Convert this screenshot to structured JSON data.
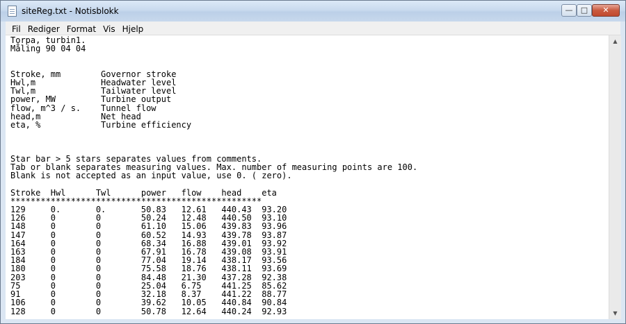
{
  "window": {
    "title": "siteReg.txt - Notisblokk",
    "controls": {
      "minimize": "—",
      "maximize": "□",
      "close": "✕"
    }
  },
  "menu": [
    "Fil",
    "Rediger",
    "Format",
    "Vis",
    "Hjelp"
  ],
  "scrollbar": {
    "up": "▲",
    "down": "▼"
  },
  "document": {
    "lines": [
      "Torpa, turbin1.",
      "Måling 90 04 04",
      "",
      "",
      "Stroke, mm        Governor stroke",
      "Hwl,m             Headwater level",
      "Twl,m             Tailwater level",
      "power, MW         Turbine output",
      "flow, m^3 / s.    Tunnel flow",
      "head,m            Net head",
      "eta, %            Turbine efficiency",
      "",
      "",
      "",
      "Star bar > 5 stars separates values from comments.",
      "Tab or blank separates measuring values. Max. number of measuring points are 100.",
      "Blank is not accepted as an input value, use 0. ( zero).",
      "",
      "Stroke  Hwl      Twl      power   flow    head    eta",
      "**************************************************",
      "129     0.       0.       50.83   12.61   440.43  93.20",
      "126     0        0        50.24   12.48   440.50  93.10",
      "148     0        0        61.10   15.06   439.83  93.96",
      "147     0        0        60.52   14.93   439.78  93.87",
      "164     0        0        68.34   16.88   439.01  93.92",
      "163     0        0        67.91   16.78   439.08  93.91",
      "184     0        0        77.04   19.14   438.17  93.56",
      "180     0        0        75.58   18.76   438.11  93.69",
      "203     0        0        84.48   21.30   437.28  92.38",
      "75      0        0        25.04   6.75    441.25  85.62",
      "91      0        0        32.18   8.37    441.22  88.77",
      "106     0        0        39.62   10.05   440.84  90.84",
      "128     0        0        50.78   12.64   440.24  92.93"
    ]
  }
}
